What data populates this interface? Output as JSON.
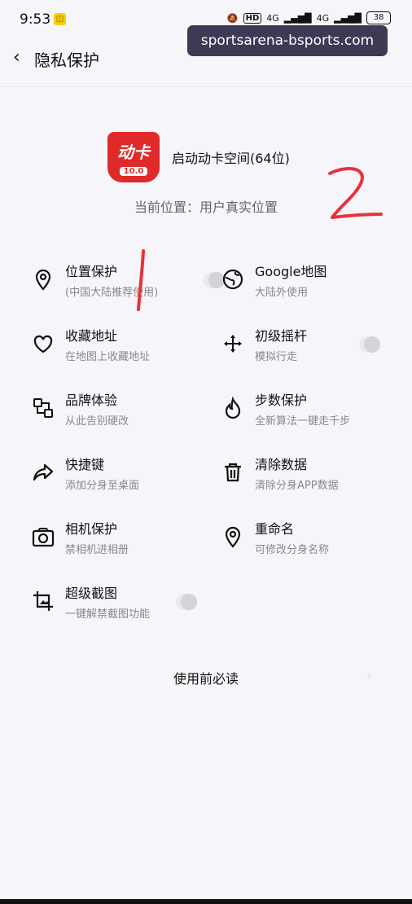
{
  "status_bar": {
    "time": "9:53",
    "icons": [
      "mute-icon",
      "hd-icon",
      "signal-icon",
      "signal-icon"
    ],
    "network_1": "4G",
    "network_2": "4G",
    "hd": "HD",
    "battery": "38"
  },
  "watermark": "sportsarena-bsports.com",
  "header": {
    "title": "隐私保护"
  },
  "app": {
    "logo_top": "动卡",
    "logo_version": "10.0",
    "name": "启动动卡空间(64位)",
    "location": "当前位置：用户真实位置"
  },
  "features": [
    {
      "title": "位置保护",
      "subtitle": "(中国大陆推荐使用)",
      "icon": "location-pin-icon",
      "toggle": true
    },
    {
      "title": "Google地图",
      "subtitle": "大陆外使用",
      "icon": "globe-icon",
      "toggle": false
    },
    {
      "title": "收藏地址",
      "subtitle": "在地图上收藏地址",
      "icon": "heart-icon",
      "toggle": false
    },
    {
      "title": "初级摇杆",
      "subtitle": "模拟行走",
      "icon": "move-arrows-icon",
      "toggle": true
    },
    {
      "title": "品牌体验",
      "subtitle": "从此告别硬改",
      "icon": "brand-swap-icon",
      "toggle": false
    },
    {
      "title": "步数保护",
      "subtitle": "全新算法一键走千步",
      "icon": "flame-icon",
      "toggle": false
    },
    {
      "title": "快捷键",
      "subtitle": "添加分身至桌面",
      "icon": "share-arrow-icon",
      "toggle": false
    },
    {
      "title": "清除数据",
      "subtitle": "清除分身APP数据",
      "icon": "trash-icon",
      "toggle": false
    },
    {
      "title": "相机保护",
      "subtitle": "禁相机进相册",
      "icon": "camera-icon",
      "toggle": false
    },
    {
      "title": "重命名",
      "subtitle": "可修改分身名称",
      "icon": "location-pin-icon",
      "toggle": false
    },
    {
      "title": "超级截图",
      "subtitle": "一键解禁截图功能",
      "icon": "screenshot-crop-icon",
      "toggle": true
    }
  ],
  "read_first": "使用前必读",
  "annotations": {
    "mark_1": "1",
    "mark_2": "2"
  },
  "colors": {
    "brand_red": "#e02a2a",
    "annotation_red": "#e8323c",
    "watermark_bg": "#3d3a56",
    "background": "#f6f6fa"
  }
}
